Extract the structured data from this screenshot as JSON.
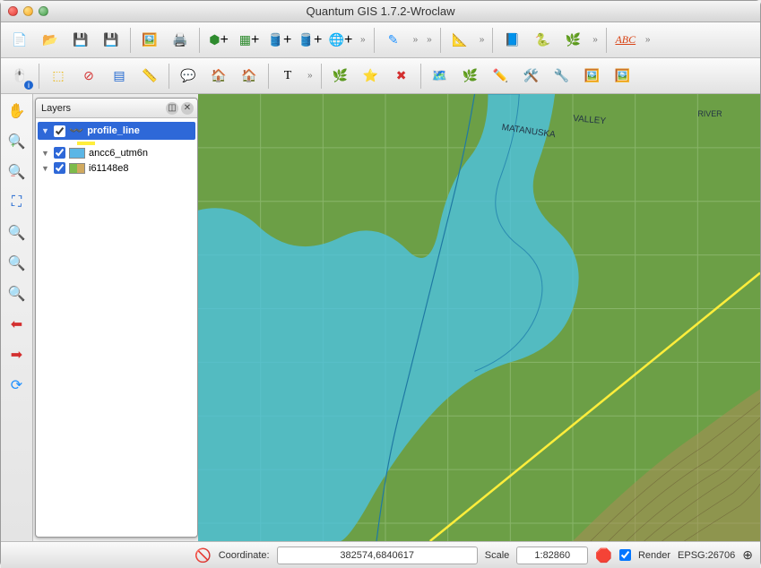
{
  "window": {
    "title": "Quantum GIS 1.7.2-Wroclaw"
  },
  "layers_panel": {
    "title": "Layers",
    "items": [
      {
        "name": "profile_line",
        "visible": true,
        "selected": true,
        "legend": "line-yellow"
      },
      {
        "name": "ancc6_utm6n",
        "visible": true,
        "selected": false,
        "legend": "raster-blue"
      },
      {
        "name": "i61148e8",
        "visible": true,
        "selected": false,
        "legend": "raster-topo"
      }
    ]
  },
  "status": {
    "coord_label": "Coordinate:",
    "coord_value": "382574,6840617",
    "scale_label": "Scale",
    "scale_value": "1:82860",
    "render_label": "Render",
    "render_checked": true,
    "crs": "EPSG:26706"
  },
  "toolbar1": {
    "new": "new-file",
    "open": "open-file",
    "save": "save",
    "saveas": "save-as",
    "composer": "print-composer",
    "print": "print",
    "addv": "add-vector-layer",
    "addr": "add-raster-layer",
    "addpg": "add-postgis-layer",
    "addsp": "add-spatialite-layer",
    "addwms": "add-wms-layer",
    "removel": "remove-layer",
    "edit": "toggle-editing",
    "coordcap": "coordinate-capture",
    "help": "help",
    "python": "python-console",
    "grass": "grass-tools",
    "abc": "labeling"
  },
  "toolbar2": {
    "identify": "identify",
    "selrect": "select-rect",
    "deselect": "deselect-all",
    "attrtable": "attribute-table",
    "measure": "measure",
    "tips": "map-tips",
    "bmk": "bookmarks",
    "bmk2": "bookmarks-new",
    "textann": "text-annotation",
    "addgrass": "add-grass-vector",
    "newgrass": "new-grass-vector",
    "closemap": "close-mapset",
    "rtools": "grass-region",
    "gtools": "grass-tools",
    "etools": "grass-edit",
    "settings": "grass-settings",
    "disp": "grass-display",
    "disp2": "grass-display-region"
  },
  "sidetools": {
    "pan": "pan",
    "zin": "zoom-in",
    "zout": "zoom-out",
    "zfull": "zoom-full",
    "zsel": "zoom-selection",
    "zlayer": "zoom-layer",
    "zlast": "zoom-last",
    "znext": "zoom-next",
    "refresh": "refresh"
  }
}
